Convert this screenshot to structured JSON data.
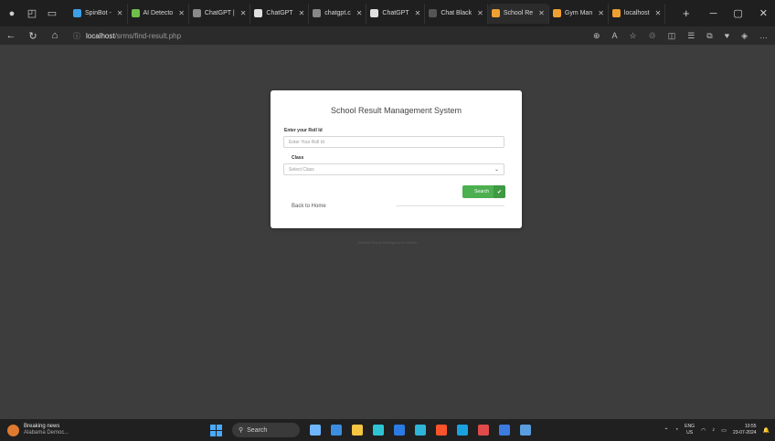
{
  "browser": {
    "tabs": [
      {
        "label": "SpinBot -",
        "color": "#3aa0e8",
        "active": false
      },
      {
        "label": "AI Detecto",
        "color": "#6fbf4a",
        "active": false
      },
      {
        "label": "ChatGPT |",
        "color": "#8a8a8a",
        "active": false
      },
      {
        "label": "ChatGPT",
        "color": "#e0e0e0",
        "active": false
      },
      {
        "label": "chatgpt.c",
        "color": "#888888",
        "active": false
      },
      {
        "label": "ChatGPT",
        "color": "#e0e0e0",
        "active": false
      },
      {
        "label": "Chat Black",
        "color": "#555555",
        "active": false
      },
      {
        "label": "School Re",
        "color": "#f0a030",
        "active": true
      },
      {
        "label": "Gym Man",
        "color": "#f0a030",
        "active": false
      },
      {
        "label": "localhost",
        "color": "#f0a030",
        "active": false
      }
    ],
    "new_tab_glyph": "+",
    "url_host": "localhost",
    "url_path": "/srms/find-result.php"
  },
  "form": {
    "title": "School Result Management System",
    "roll_label": "Enter your Roll Id",
    "roll_placeholder": "Enter Your Roll Id",
    "class_label": "Class",
    "class_selected": "Select Class",
    "search_label": "Search",
    "back_label": "Back to Home",
    "footer": "Student Result Management System"
  },
  "taskbar": {
    "news_title": "Breaking news",
    "news_sub": "Alabama Democ...",
    "search_label": "Search",
    "lang_top": "ENG",
    "lang_bottom": "US",
    "time": "10:55",
    "date": "23-07-2024",
    "apps": [
      "#6fb6ff",
      "#3b8ee0",
      "#f5c542",
      "#2ec4d6",
      "#2c7be5",
      "#2eb5d9",
      "#fb542b",
      "#1aa1e0",
      "#e04a4a",
      "#3c7be0",
      "#5a9ee0"
    ]
  }
}
